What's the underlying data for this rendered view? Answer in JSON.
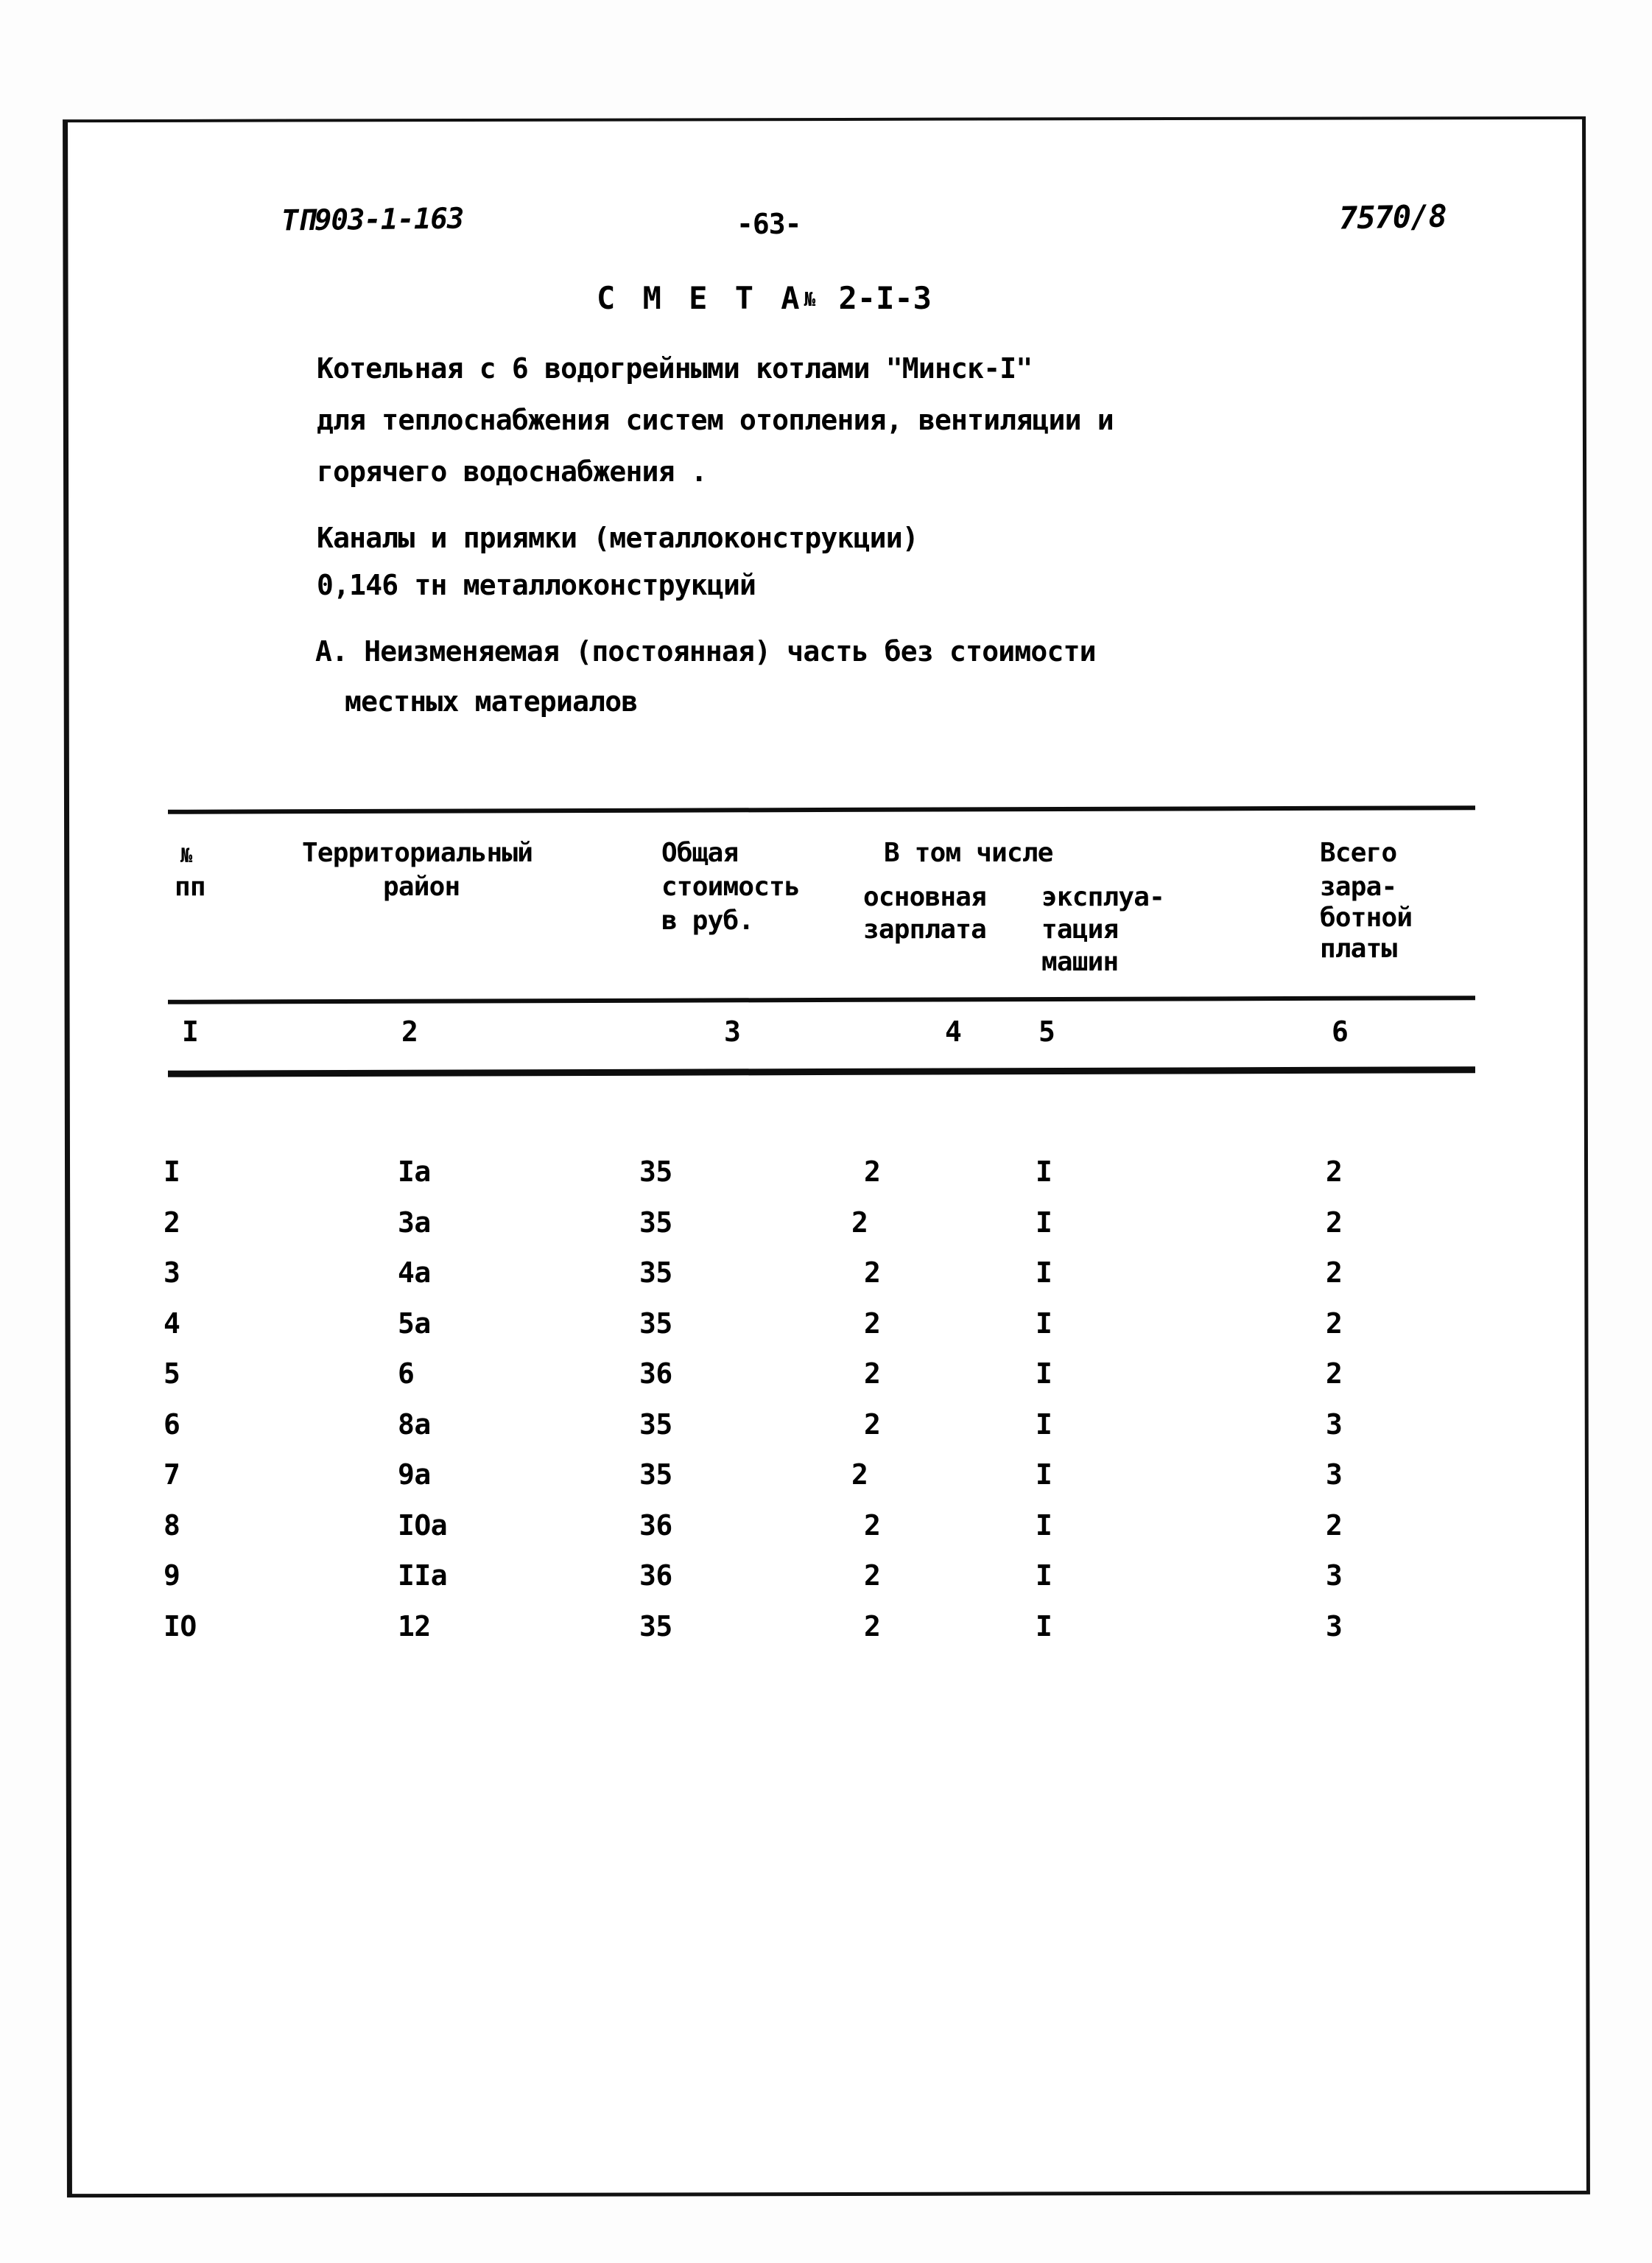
{
  "header": {
    "doc_code": "ТП903-1-163",
    "page_number": "-63-",
    "doc_ref": "7570/8"
  },
  "title": {
    "word": "С М Е Т А",
    "number_symbol": "№",
    "number": "2-I-3"
  },
  "description": {
    "line1": "Котельная  с  6 водогрейными котлами \"Минск-I\"",
    "line2": "для теплоснабжения систем отопления, вентиляции и",
    "line3": "горячего водоснабжения .",
    "line4": "Каналы и приямки (металлоконструкции)",
    "line5": "0,146 тн металлоконструкций",
    "line6": "А. Неизменяемая (постоянная) часть без стоимости",
    "line7": "местных материалов"
  },
  "table": {
    "headers": {
      "num_symbol": "№",
      "num_sub": "пп",
      "region_l1": "Территориальный",
      "region_l2": "район",
      "cost_l1": "Общая",
      "cost_l2": "стоимость",
      "cost_l3": "в руб.",
      "among_which": "В том числе",
      "basic_l1": "основная",
      "basic_l2": "зарплата",
      "oper_l1": "эксплуа-",
      "oper_l2": "тация",
      "oper_l3": "машин",
      "total_l1": "Всего",
      "total_l2": "зара-",
      "total_l3": "ботной",
      "total_l4": "платы"
    },
    "column_numbers": [
      "I",
      "2",
      "3",
      "4",
      "5",
      "6"
    ],
    "rows": [
      {
        "no": "I",
        "region": "Ia",
        "cost": "35",
        "basic": "2",
        "oper": "I",
        "total": "2"
      },
      {
        "no": "2",
        "region": "3a",
        "cost": "35",
        "basic": "2",
        "oper": "I",
        "total": "2"
      },
      {
        "no": "3",
        "region": "4a",
        "cost": "35",
        "basic": "2",
        "oper": "I",
        "total": "2"
      },
      {
        "no": "4",
        "region": "5a",
        "cost": "35",
        "basic": "2",
        "oper": "I",
        "total": "2"
      },
      {
        "no": "5",
        "region": "6",
        "cost": "36",
        "basic": "2",
        "oper": "I",
        "total": "2"
      },
      {
        "no": "6",
        "region": "8a",
        "cost": "35",
        "basic": "2",
        "oper": "I",
        "total": "3"
      },
      {
        "no": "7",
        "region": "9a",
        "cost": "35",
        "basic": "2",
        "oper": "I",
        "total": "3"
      },
      {
        "no": "8",
        "region": "IOa",
        "cost": "36",
        "basic": "2",
        "oper": "I",
        "total": "2"
      },
      {
        "no": "9",
        "region": "IIa",
        "cost": "36",
        "basic": "2",
        "oper": "I",
        "total": "3"
      },
      {
        "no": "IO",
        "region": "12",
        "cost": "35",
        "basic": "2",
        "oper": "I",
        "total": "3"
      }
    ]
  }
}
